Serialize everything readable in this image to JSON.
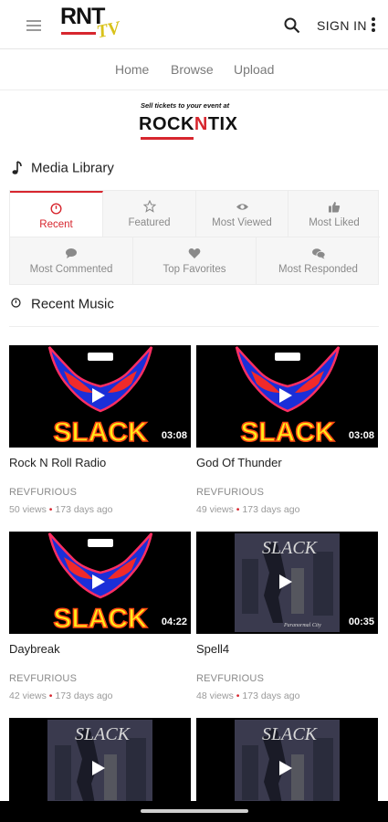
{
  "header": {
    "logo_text": "RNT",
    "logo_sub": "TV",
    "signin_label": "SIGN IN"
  },
  "nav": {
    "items": [
      "Home",
      "Browse",
      "Upload"
    ]
  },
  "banner": {
    "tagline": "Sell tickets to your event at",
    "brand_a": "ROCK",
    "brand_n": "N",
    "brand_b": "TIX"
  },
  "media_library": {
    "title": "Media Library",
    "tabs": [
      {
        "label": "Recent",
        "icon": "clock-icon",
        "active": true
      },
      {
        "label": "Featured",
        "icon": "star-icon",
        "active": false
      },
      {
        "label": "Most Viewed",
        "icon": "eye-icon",
        "active": false
      },
      {
        "label": "Most Liked",
        "icon": "thumbs-up-icon",
        "active": false
      },
      {
        "label": "Most Commented",
        "icon": "comment-icon",
        "active": false
      },
      {
        "label": "Top Favorites",
        "icon": "heart-icon",
        "active": false
      },
      {
        "label": "Most Responded",
        "icon": "comments-icon",
        "active": false
      }
    ]
  },
  "recent_music": {
    "title": "Recent Music",
    "videos": [
      {
        "title": "Rock N Roll Radio",
        "user": "REVFURIOUS",
        "views": "50 views",
        "age": "173 days ago",
        "duration": "03:08",
        "art": "slack-alien"
      },
      {
        "title": "God Of Thunder",
        "user": "REVFURIOUS",
        "views": "49 views",
        "age": "173 days ago",
        "duration": "03:08",
        "art": "slack-alien"
      },
      {
        "title": "Daybreak",
        "user": "REVFURIOUS",
        "views": "42 views",
        "age": "173 days ago",
        "duration": "04:22",
        "art": "slack-alien"
      },
      {
        "title": "Spell4",
        "user": "REVFURIOUS",
        "views": "48 views",
        "age": "173 days ago",
        "duration": "00:35",
        "art": "slack-album"
      },
      {
        "title": "",
        "user": "",
        "views": "",
        "age": "",
        "duration": "",
        "art": "slack-album"
      },
      {
        "title": "",
        "user": "",
        "views": "",
        "age": "",
        "duration": "",
        "art": "slack-album"
      }
    ]
  },
  "colors": {
    "accent": "#d7262e",
    "logo_yellow": "#d9c21a"
  }
}
